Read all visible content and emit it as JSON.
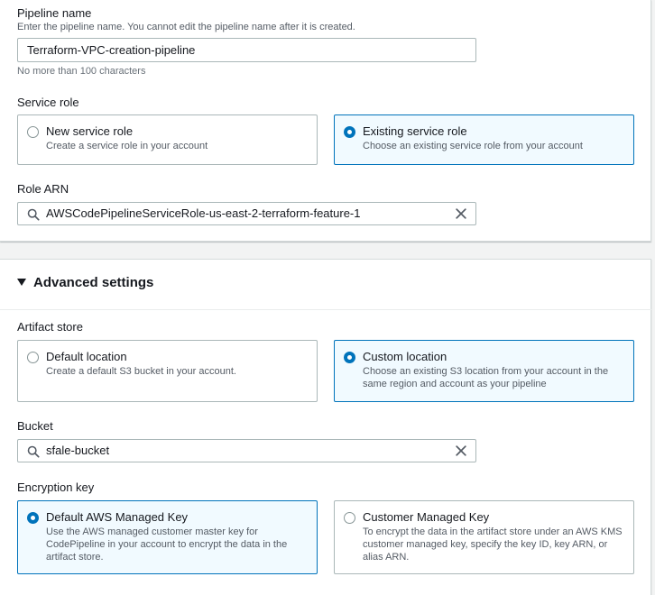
{
  "pipeline": {
    "label": "Pipeline name",
    "description": "Enter the pipeline name. You cannot edit the pipeline name after it is created.",
    "value": "Terraform-VPC-creation-pipeline",
    "constraint": "No more than 100 characters"
  },
  "service_role": {
    "label": "Service role",
    "options": [
      {
        "title": "New service role",
        "description": "Create a service role in your account",
        "selected": false
      },
      {
        "title": "Existing service role",
        "description": "Choose an existing service role from your account",
        "selected": true
      }
    ]
  },
  "role_arn": {
    "label": "Role ARN",
    "value": "AWSCodePipelineServiceRole-us-east-2-terraform-feature-1"
  },
  "advanced": {
    "header": "Advanced settings",
    "artifact_store": {
      "label": "Artifact store",
      "options": [
        {
          "title": "Default location",
          "description": "Create a default S3 bucket in your account.",
          "selected": false
        },
        {
          "title": "Custom location",
          "description": "Choose an existing S3 location from your account in the same region and account as your pipeline",
          "selected": true
        }
      ]
    },
    "bucket": {
      "label": "Bucket",
      "value": "sfale-bucket"
    },
    "encryption": {
      "label": "Encryption key",
      "options": [
        {
          "title": "Default AWS Managed Key",
          "description": "Use the AWS managed customer master key for CodePipeline in your account to encrypt the data in the artifact store.",
          "selected": true
        },
        {
          "title": "Customer Managed Key",
          "description": "To encrypt the data in the artifact store under an AWS KMS customer managed key, specify the key ID, key ARN, or alias ARN.",
          "selected": false
        }
      ]
    }
  },
  "colors": {
    "accent": "#0073bb",
    "selected_bg": "#f1faff",
    "border": "#aab7b8"
  }
}
